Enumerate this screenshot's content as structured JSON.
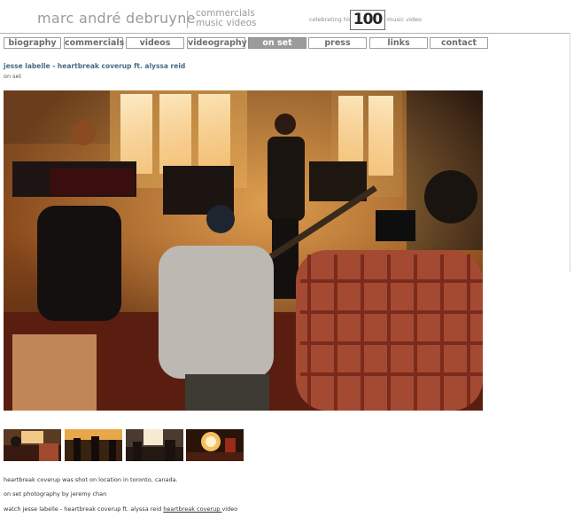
{
  "header": {
    "site_name": "marc andré debruyne",
    "subtitle_line1": "commercials",
    "subtitle_line2": "music videos",
    "celebrating_text": "celebrating his",
    "badge_number": "100",
    "music_video_text": "music video"
  },
  "nav": {
    "items": [
      {
        "label": "biography"
      },
      {
        "label": "commercials"
      },
      {
        "label": "videos"
      },
      {
        "label": "videography"
      },
      {
        "label": "on set"
      },
      {
        "label": "press"
      },
      {
        "label": "links"
      },
      {
        "label": "contact"
      }
    ],
    "active": "on set"
  },
  "post": {
    "title": "jesse labelle - heartbreak coverup ft. alyssa reid",
    "category": "on set",
    "thumbnail_count": 4,
    "description_line1": "heartbreak coverup was shot on location in toronto, canada.",
    "description_line2": "on set photography by jeremy chan",
    "description_line3_prefix": "watch jesse labelle - heartbreak coverup ft. alyssa reid ",
    "description_line3_link": "heartbreak coverup ",
    "description_line3_suffix": "video"
  },
  "colors": {
    "title_blue": "#456a83",
    "nav_active_bg": "#9b9b9b",
    "nav_border": "#9f9f9f",
    "header_gray": "#9a9a9a"
  }
}
